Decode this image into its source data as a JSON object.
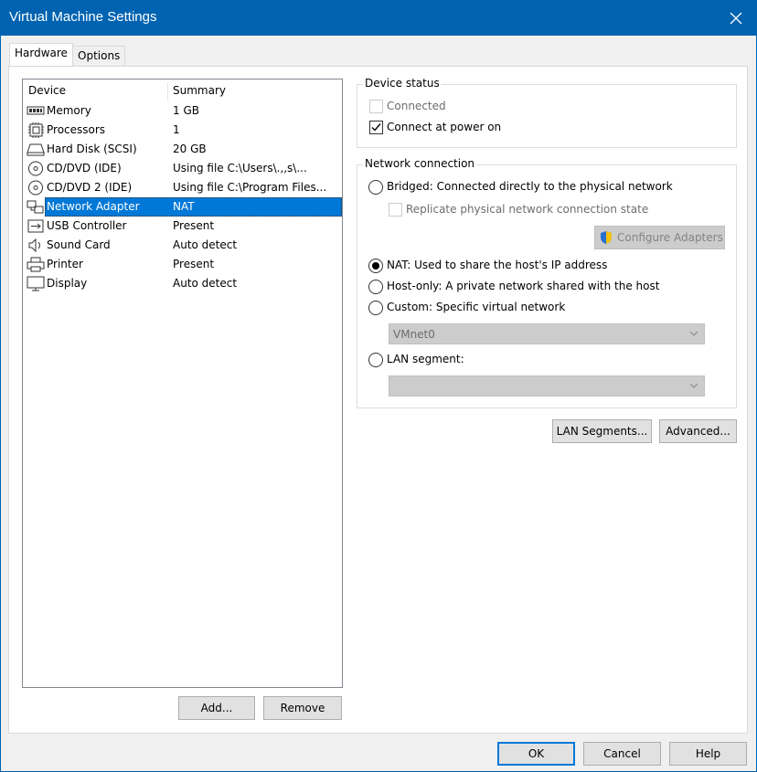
{
  "window": {
    "title": "Virtual Machine Settings"
  },
  "tabs": [
    {
      "label": "Hardware",
      "active": true
    },
    {
      "label": "Options",
      "active": false
    }
  ],
  "device_list": {
    "headers": {
      "device": "Device",
      "summary": "Summary"
    },
    "rows": [
      {
        "icon": "memory-icon",
        "name": "Memory",
        "summary": "1 GB"
      },
      {
        "icon": "processor-icon",
        "name": "Processors",
        "summary": "1"
      },
      {
        "icon": "hard-disk-icon",
        "name": "Hard Disk (SCSI)",
        "summary": "20 GB"
      },
      {
        "icon": "cd-dvd-icon",
        "name": "CD/DVD (IDE)",
        "summary": "Using file C:\\Users\\.,,s\\..."
      },
      {
        "icon": "cd-dvd-icon",
        "name": "CD/DVD 2 (IDE)",
        "summary": "Using file C:\\Program Files..."
      },
      {
        "icon": "network-adapter-icon",
        "name": "Network Adapter",
        "summary": "NAT",
        "selected": true
      },
      {
        "icon": "usb-icon",
        "name": "USB Controller",
        "summary": "Present"
      },
      {
        "icon": "speaker-icon",
        "name": "Sound Card",
        "summary": "Auto detect"
      },
      {
        "icon": "printer-icon",
        "name": "Printer",
        "summary": "Present"
      },
      {
        "icon": "display-icon",
        "name": "Display",
        "summary": "Auto detect"
      }
    ]
  },
  "list_buttons": {
    "add": "Add...",
    "remove": "Remove"
  },
  "device_status": {
    "legend": "Device status",
    "connected": {
      "label": "Connected",
      "checked": false,
      "enabled": false
    },
    "connect_at_power_on": {
      "label": "Connect at power on",
      "checked": true,
      "enabled": true
    }
  },
  "network_connection": {
    "legend": "Network connection",
    "bridged": {
      "label": "Bridged: Connected directly to the physical network",
      "selected": false
    },
    "replicate": {
      "label": "Replicate physical network connection state",
      "checked": false,
      "enabled": false
    },
    "configure_adapters": "Configure Adapters",
    "nat": {
      "label": "NAT: Used to share the host's IP address",
      "selected": true
    },
    "host_only": {
      "label": "Host-only: A private network shared with the host",
      "selected": false
    },
    "custom": {
      "label": "Custom: Specific virtual network",
      "selected": false
    },
    "custom_network_value": "VMnet0",
    "lan_segment": {
      "label": "LAN segment:",
      "selected": false
    },
    "lan_segment_value": ""
  },
  "network_buttons": {
    "lan_segments": "LAN Segments...",
    "advanced": "Advanced..."
  },
  "footer_buttons": {
    "ok": "OK",
    "cancel": "Cancel",
    "help": "Help"
  },
  "colors": {
    "titlebar": "#0063b1",
    "selection": "#0078d7"
  }
}
